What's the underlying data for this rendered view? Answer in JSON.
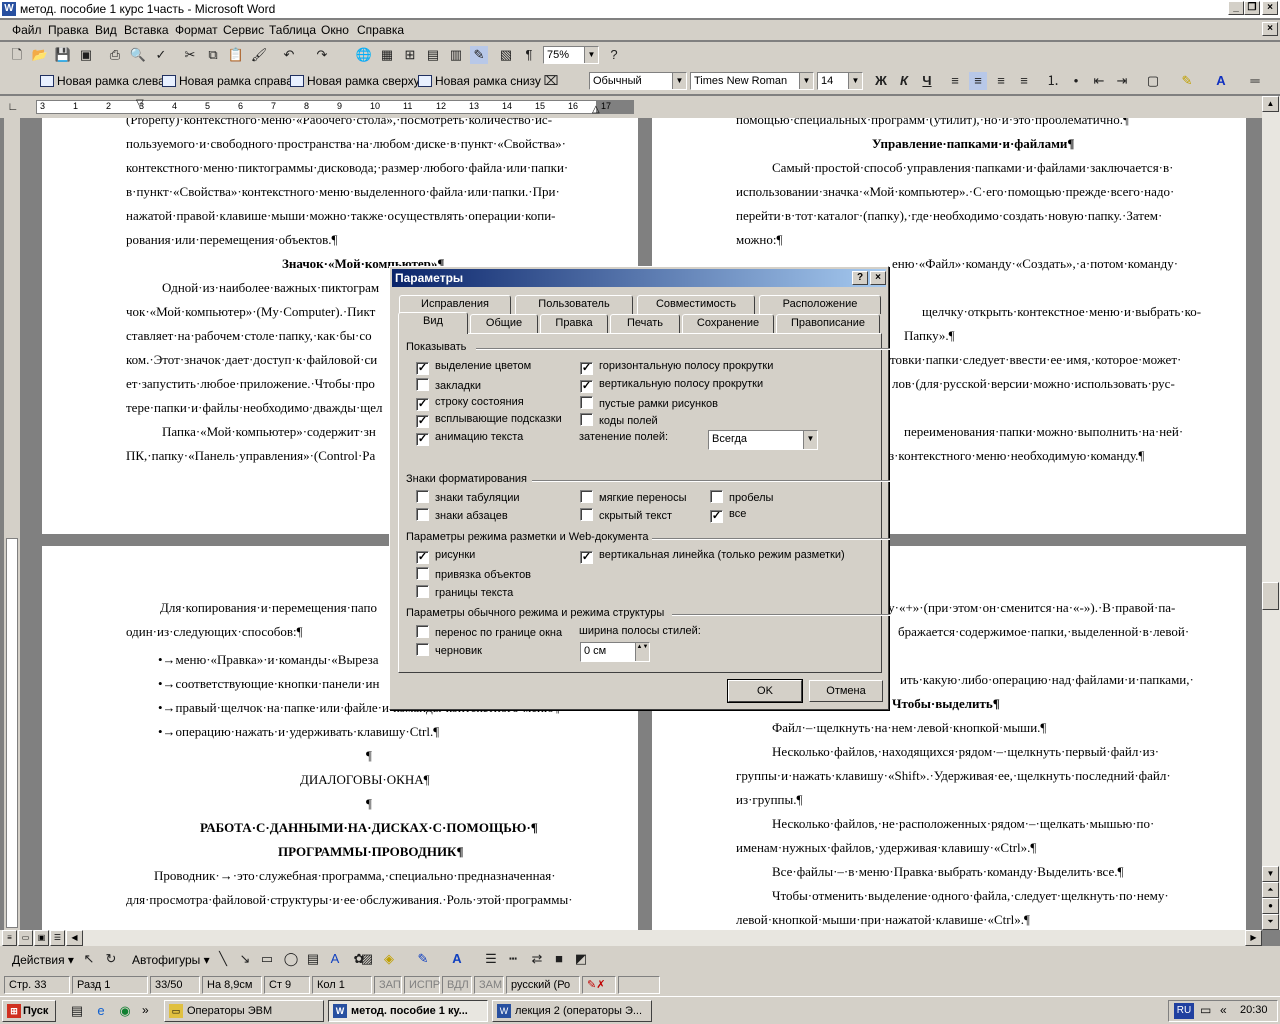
{
  "window": {
    "title": "метод. пособие 1 курс 1часть - Microsoft Word"
  },
  "menu": [
    "Файл",
    "Правка",
    "Вид",
    "Вставка",
    "Формат",
    "Сервис",
    "Таблица",
    "Окно",
    "Справка"
  ],
  "toolbar": {
    "zoom": "75%",
    "frame_left": "Новая рамка слева",
    "frame_right": "Новая рамка справа",
    "frame_top": "Новая рамка сверху",
    "frame_bottom": "Новая рамка снизу",
    "style": "Обычный",
    "font": "Times New Roman",
    "size": "14",
    "bold": "Ж",
    "italic": "К",
    "underline": "Ч"
  },
  "ruler": {
    "ticks": [
      "3",
      "1",
      "2",
      "3",
      "4",
      "5",
      "6",
      "7",
      "8",
      "9",
      "10",
      "11",
      "12",
      "13",
      "14",
      "15",
      "16",
      "17"
    ]
  },
  "page1": {
    "lines": [
      "(Property)·контекстного·меню·«Рабочего·стола»,·посмотреть·количество·ис-",
      "пользуемого·и·свободного·пространства·на·любом·диске·в·пункт·«Свойства»·",
      "контекстного·меню·пиктограммы·дисковода;·размер·любого·файла·или·папки·",
      "в·пункт·«Свойства»·контекстного·меню·выделенного·файла·или·папки.·При·",
      "нажатой·правой·клавише·мыши·можно·также·осуществлять·операции·копи-",
      "рования·или·перемещения·объектов.¶",
      "Значок·«Мой·компьютер»¶",
      "Одной·из·наиболее·важных·пиктограм",
      "чок·«Мой·компьютер»·(My·Computer).·Пикт",
      "ставляет·на·рабочем·столе·папку,·как·бы·со",
      "ком.·Этот·значок·дает·доступ·к·файловой·си",
      "ет·запустить·любое·приложение.·Чтобы·про",
      "тере·папки·и·файлы·необходимо·дважды·щел",
      "Папка·«Мой·компьютер»·содержит·зн",
      "ПК,·папку·«Панель·управления»·(Control·Pa"
    ]
  },
  "page2": {
    "lines": [
      "помощью·специальных·программ·(утилит),·но·и·это·проблематично.¶",
      "Управление·папками·и·файлами¶",
      "Самый·простой·способ·управления·папками·и·файлами·заключается·в·",
      "использовании·значка·«Мой·компьютер».·С·его·помощью·прежде·всего·надо·",
      "перейти·в·тот·каталог·(папку),·где·необходимо·создать·новую·папку.·Затем·",
      "можно:¶",
      "еню·«Файл»·команду·«Создать»,·а·потом·команду·",
      "щелчку·открыть·контекстное·меню·и·выбрать·ко-",
      "Папку».¶",
      "товки·папки·следует·ввести·ее·имя,·которое·может·",
      "лов·(для·русской·версии·можно·использовать·рус-",
      "переименования·папки·можно·выполнить·на·ней·",
      "из·контекстного·меню·необходимую·команду.¶"
    ]
  },
  "page3": {
    "lines": [
      "Для·копирования·и·перемещения·папо",
      "один·из·следующих·способов:¶",
      "•→меню·«Правка»·и·команды·«Выреза",
      "•→соответствующие·кнопки·панели·ин",
      "•→правый·щелчок·на·папке·или·файле·и·команды·контекстного·меню¶",
      "•→операцию·нажать·и·удерживать·клавишу·Ctrl.¶",
      "¶",
      "ДИАЛОГОВЫ·ОКНА¶",
      "¶",
      "РАБОТА·С·ДАННЫМИ·НА·ДИСКАХ·С·ПОМОЩЬЮ·¶",
      "ПРОГРАММЫ·ПРОВОДНИК¶",
      "Проводник·→·это·служебная·программа,·специально·предназначенная·",
      "для·просмотра·файловой·структуры·и·ее·обслуживания.·Роль·этой·программы·"
    ]
  },
  "page4": {
    "lines": [
      "ку·«+»·(при·этом·он·сменится·на·«-»).·В·правой·па-",
      "бражается·содержимое·папки,·выделенной·в·левой·",
      "ить·какую·либо·операцию·над·файлами·и·папками,·",
      "Чтобы·выделить¶",
      "Файл·–·щелкнуть·на·нем·левой·кнопкой·мыши.¶",
      "Несколько·файлов,·находящихся·рядом·–·щелкнуть·первый·файл·из·",
      "группы·и·нажать·клавишу·«Shift».·Удерживая·ее,·щелкнуть·последний·файл·",
      "из·группы.¶",
      "Несколько·файлов,·не·расположенных·рядом·–·щелкать·мышью·по·",
      "именам·нужных·файлов,·удерживая·клавишу·«Ctrl».¶",
      "Все·файлы·–·в·меню·Правка·выбрать·команду·Выделить·все.¶",
      "Чтобы·отменить·выделение·одного·файла,·следует·щелкнуть·по·нему·",
      "левой·кнопкой·мыши·при·нажатой·клавише·«Ctrl».¶"
    ]
  },
  "dialog": {
    "title": "Параметры",
    "help": "?",
    "close": "×",
    "tabs_back": [
      "Исправления",
      "Пользователь",
      "Совместимость",
      "Расположение"
    ],
    "tabs_front": [
      "Вид",
      "Общие",
      "Правка",
      "Печать",
      "Сохранение",
      "Правописание"
    ],
    "groups": {
      "show": "Показывать",
      "format": "Знаки форматирования",
      "layout": "Параметры режима разметки и Web-документа",
      "normal": "Параметры обычного режима и режима структуры"
    },
    "show_left": [
      {
        "label": "выделение цветом",
        "checked": true
      },
      {
        "label": "закладки",
        "checked": false
      },
      {
        "label": "строку состояния",
        "checked": true
      },
      {
        "label": "всплывающие подсказки",
        "checked": true
      },
      {
        "label": "анимацию текста",
        "checked": true
      }
    ],
    "show_right": [
      {
        "label": "горизонтальную полосу прокрутки",
        "checked": true
      },
      {
        "label": "вертикальную полосу прокрутки",
        "checked": true
      },
      {
        "label": "пустые рамки рисунков",
        "checked": false
      },
      {
        "label": "коды полей",
        "checked": false
      }
    ],
    "shading_label": "затенение полей:",
    "shading_value": "Всегда",
    "fmt": [
      {
        "label": "знаки табуляции",
        "checked": false
      },
      {
        "label": "знаки абзацев",
        "checked": false
      },
      {
        "label": "мягкие переносы",
        "checked": false
      },
      {
        "label": "скрытый текст",
        "checked": false
      },
      {
        "label": "пробелы",
        "checked": false
      },
      {
        "label": "все",
        "checked": true
      }
    ],
    "layout": [
      {
        "label": "рисунки",
        "checked": true
      },
      {
        "label": "привязка объектов",
        "checked": false
      },
      {
        "label": "границы текста",
        "checked": false
      },
      {
        "label": "вертикальная линейка (только режим разметки)",
        "checked": true
      }
    ],
    "normal": [
      {
        "label": "перенос по границе окна",
        "checked": false
      },
      {
        "label": "черновик",
        "checked": false
      }
    ],
    "stylewidth_label": "ширина полосы стилей:",
    "stylewidth_value": "0 см",
    "ok": "OK",
    "cancel": "Отмена"
  },
  "drawbar": {
    "actions": "Действия",
    "autoshapes": "Автофигуры"
  },
  "status": {
    "page": "Стр. 33",
    "section": "Разд 1",
    "pages": "33/50",
    "at": "На 8,9см",
    "line": "Ст 9",
    "col": "Кол 1",
    "rec": "ЗАП",
    "trk": "ИСПР",
    "ext": "ВДЛ",
    "ovr": "ЗАМ",
    "lang": "русский (Ро"
  },
  "taskbar": {
    "start": "Пуск",
    "tasks": [
      "Операторы ЭВМ",
      "метод. пособие 1 ку...",
      "лекция 2 (операторы Э..."
    ],
    "lang": "RU",
    "time": "20:30"
  },
  "colors": {
    "title_active": "#0a246a",
    "face": "#d4d0c8"
  }
}
